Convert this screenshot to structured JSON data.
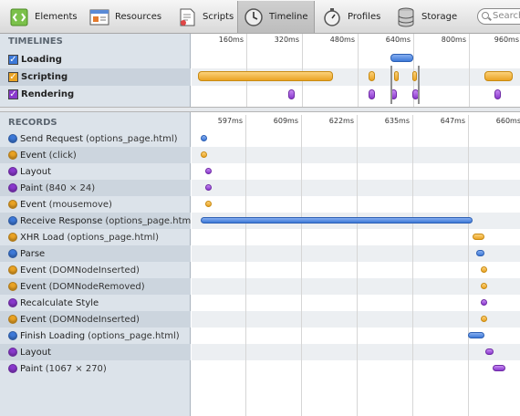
{
  "toolbar": {
    "items": [
      {
        "label": "Elements",
        "icon": "elements-icon"
      },
      {
        "label": "Resources",
        "icon": "resources-icon"
      },
      {
        "label": "Scripts",
        "icon": "scripts-icon"
      },
      {
        "label": "Timeline",
        "icon": "timeline-icon",
        "active": true
      },
      {
        "label": "Profiles",
        "icon": "profiles-icon"
      },
      {
        "label": "Storage",
        "icon": "storage-icon"
      }
    ],
    "search_placeholder": "Search"
  },
  "timelines": {
    "heading": "TIMELINES",
    "ticks": [
      "160ms",
      "320ms",
      "480ms",
      "640ms",
      "800ms",
      "960ms"
    ],
    "rows": [
      {
        "label": "Loading",
        "checked": true,
        "color": "#3d79d8"
      },
      {
        "label": "Scripting",
        "checked": true,
        "color": "#eaa324"
      },
      {
        "label": "Rendering",
        "checked": true,
        "color": "#8a39cd"
      }
    ]
  },
  "records": {
    "heading": "RECORDS",
    "ticks": [
      "597ms",
      "609ms",
      "622ms",
      "635ms",
      "647ms",
      "660ms"
    ],
    "rows": [
      {
        "name": "Send Request",
        "detail": "(options_page.html)",
        "category": "loading"
      },
      {
        "name": "Event",
        "detail": "(click)",
        "category": "scripting"
      },
      {
        "name": "Layout",
        "detail": "",
        "category": "rendering"
      },
      {
        "name": "Paint",
        "detail": "(840 × 24)",
        "category": "rendering"
      },
      {
        "name": "Event",
        "detail": "(mousemove)",
        "category": "scripting"
      },
      {
        "name": "Receive Response",
        "detail": "(options_page.html)",
        "category": "loading"
      },
      {
        "name": "XHR Load",
        "detail": "(options_page.html)",
        "category": "scripting"
      },
      {
        "name": "Parse",
        "detail": "",
        "category": "loading"
      },
      {
        "name": "Event",
        "detail": "(DOMNodeInserted)",
        "category": "scripting"
      },
      {
        "name": "Event",
        "detail": "(DOMNodeRemoved)",
        "category": "scripting"
      },
      {
        "name": "Recalculate Style",
        "detail": "",
        "category": "rendering"
      },
      {
        "name": "Event",
        "detail": "(DOMNodeInserted)",
        "category": "scripting"
      },
      {
        "name": "Finish Loading",
        "detail": "(options_page.html)",
        "category": "loading"
      },
      {
        "name": "Layout",
        "detail": "",
        "category": "rendering"
      },
      {
        "name": "Paint",
        "detail": "(1067 × 270)",
        "category": "rendering"
      }
    ]
  },
  "colors": {
    "loading": "#3d79d8",
    "scripting": "#eaa324",
    "rendering": "#8a39cd"
  }
}
